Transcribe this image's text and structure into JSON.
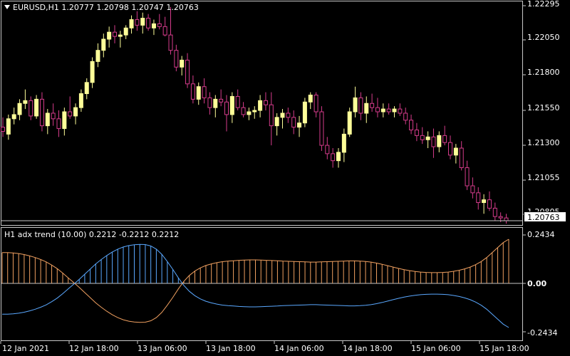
{
  "main_chart": {
    "title": "EURUSD,H1  1.20777 1.20798 1.20747 1.20763",
    "current_price": "1.20763",
    "price_labels": [
      "1.22295",
      "1.22050",
      "1.21800",
      "1.21550",
      "1.21300",
      "1.21055",
      "1.20805"
    ],
    "colors": {
      "bull": "#ffff99",
      "bear": "#d63c8c",
      "price_line": "#c8c8c8"
    }
  },
  "indicator": {
    "title": "H1 adx trend (10.00) 0.2212 -0.2212 0.2212",
    "level_labels": [
      "0.2434",
      "0.00",
      "-0.2434"
    ],
    "colors": {
      "up": "#5aa8ff",
      "down": "#f0a060"
    }
  },
  "time_axis": {
    "labels": [
      "12 Jan 2021",
      "12 Jan 18:00",
      "13 Jan 06:00",
      "13 Jan 18:00",
      "14 Jan 06:00",
      "14 Jan 18:00",
      "15 Jan 06:00",
      "15 Jan 18:00"
    ]
  },
  "chart_data": [
    {
      "type": "candlestick",
      "title": "EURUSD,H1",
      "ylim": [
        1.2075,
        1.2232
      ],
      "ohlc": [
        [
          1.2143,
          1.215,
          1.2136,
          1.214
        ],
        [
          1.2138,
          1.2152,
          1.2134,
          1.2149
        ],
        [
          1.2149,
          1.2157,
          1.2145,
          1.2152
        ],
        [
          1.2152,
          1.2163,
          1.2148,
          1.216
        ],
        [
          1.216,
          1.217,
          1.2156,
          1.2162
        ],
        [
          1.2162,
          1.2165,
          1.2148,
          1.2151
        ],
        [
          1.2151,
          1.2166,
          1.2149,
          1.2163
        ],
        [
          1.2163,
          1.2168,
          1.214,
          1.2144
        ],
        [
          1.2144,
          1.2156,
          1.2138,
          1.2153
        ],
        [
          1.2153,
          1.216,
          1.2144,
          1.2149
        ],
        [
          1.2149,
          1.2155,
          1.2136,
          1.2142
        ],
        [
          1.2142,
          1.2157,
          1.2137,
          1.2154
        ],
        [
          1.2154,
          1.2165,
          1.2149,
          1.2151
        ],
        [
          1.2151,
          1.216,
          1.2145,
          1.2157
        ],
        [
          1.2157,
          1.217,
          1.2154,
          1.2167
        ],
        [
          1.2167,
          1.2178,
          1.2163,
          1.2175
        ],
        [
          1.2175,
          1.2193,
          1.2171,
          1.219
        ],
        [
          1.219,
          1.2203,
          1.2186,
          1.2198
        ],
        [
          1.2198,
          1.221,
          1.2193,
          1.2206
        ],
        [
          1.2206,
          1.2215,
          1.22,
          1.2211
        ],
        [
          1.2211,
          1.2216,
          1.2203,
          1.2208
        ],
        [
          1.2208,
          1.2212,
          1.22,
          1.2209
        ],
        [
          1.2209,
          1.2216,
          1.2206,
          1.2214
        ],
        [
          1.2214,
          1.2223,
          1.221,
          1.222
        ],
        [
          1.222,
          1.2226,
          1.2212,
          1.2216
        ],
        [
          1.2216,
          1.2225,
          1.221,
          1.2221
        ],
        [
          1.2221,
          1.2224,
          1.2212,
          1.2214
        ],
        [
          1.2214,
          1.222,
          1.2209,
          1.2217
        ],
        [
          1.2217,
          1.2224,
          1.2213,
          1.2215
        ],
        [
          1.2215,
          1.2222,
          1.2208,
          1.2209
        ],
        [
          1.2209,
          1.2229,
          1.2195,
          1.2198
        ],
        [
          1.2198,
          1.2202,
          1.2183,
          1.2186
        ],
        [
          1.2186,
          1.2194,
          1.218,
          1.2191
        ],
        [
          1.2191,
          1.2196,
          1.2171,
          1.2174
        ],
        [
          1.2174,
          1.218,
          1.216,
          1.2163
        ],
        [
          1.2163,
          1.2175,
          1.2159,
          1.2172
        ],
        [
          1.2172,
          1.2178,
          1.216,
          1.2164
        ],
        [
          1.2164,
          1.2168,
          1.2152,
          1.2157
        ],
        [
          1.2157,
          1.2166,
          1.215,
          1.2163
        ],
        [
          1.2163,
          1.217,
          1.2158,
          1.2161
        ],
        [
          1.2161,
          1.2166,
          1.214,
          1.2152
        ],
        [
          1.2152,
          1.2168,
          1.2146,
          1.2165
        ],
        [
          1.2165,
          1.217,
          1.2155,
          1.2157
        ],
        [
          1.2157,
          1.2161,
          1.215,
          1.2152
        ],
        [
          1.2152,
          1.2157,
          1.2148,
          1.2154
        ],
        [
          1.2154,
          1.2158,
          1.2149,
          1.2155
        ],
        [
          1.2155,
          1.2166,
          1.215,
          1.2162
        ],
        [
          1.2162,
          1.2168,
          1.2155,
          1.2159
        ],
        [
          1.2159,
          1.2168,
          1.213,
          1.2144
        ],
        [
          1.2144,
          1.2153,
          1.2137,
          1.215
        ],
        [
          1.215,
          1.2156,
          1.2142,
          1.2153
        ],
        [
          1.2153,
          1.2157,
          1.2146,
          1.215
        ],
        [
          1.215,
          1.2155,
          1.2138,
          1.2143
        ],
        [
          1.2143,
          1.2151,
          1.2136,
          1.2146
        ],
        [
          1.2146,
          1.2164,
          1.2143,
          1.2161
        ],
        [
          1.2161,
          1.2168,
          1.2156,
          1.2166
        ],
        [
          1.2166,
          1.2168,
          1.215,
          1.2154
        ],
        [
          1.2154,
          1.2158,
          1.2126,
          1.213
        ],
        [
          1.213,
          1.2136,
          1.212,
          1.2124
        ],
        [
          1.2124,
          1.2128,
          1.2114,
          1.2119
        ],
        [
          1.2119,
          1.2128,
          1.2114,
          1.2125
        ],
        [
          1.2125,
          1.2142,
          1.2118,
          1.2138
        ],
        [
          1.2138,
          1.2157,
          1.2136,
          1.2154
        ],
        [
          1.2154,
          1.2172,
          1.215,
          1.2164
        ],
        [
          1.2164,
          1.2168,
          1.2148,
          1.2153
        ],
        [
          1.2153,
          1.2165,
          1.2146,
          1.216
        ],
        [
          1.216,
          1.2167,
          1.2154,
          1.2157
        ],
        [
          1.2157,
          1.2164,
          1.215,
          1.2154
        ],
        [
          1.2154,
          1.216,
          1.215,
          1.2156
        ],
        [
          1.2156,
          1.216,
          1.2152,
          1.2154
        ],
        [
          1.2154,
          1.2158,
          1.215,
          1.2156
        ],
        [
          1.2156,
          1.216,
          1.2151,
          1.2153
        ],
        [
          1.2153,
          1.2157,
          1.2145,
          1.2148
        ],
        [
          1.2148,
          1.2152,
          1.2138,
          1.2141
        ],
        [
          1.2141,
          1.2146,
          1.2133,
          1.2137
        ],
        [
          1.2137,
          1.2143,
          1.2131,
          1.2134
        ],
        [
          1.2134,
          1.214,
          1.2128,
          1.2136
        ],
        [
          1.2136,
          1.2142,
          1.2121,
          1.2129
        ],
        [
          1.2129,
          1.214,
          1.2125,
          1.2137
        ],
        [
          1.2137,
          1.2144,
          1.213,
          1.2132
        ],
        [
          1.2132,
          1.2137,
          1.212,
          1.2123
        ],
        [
          1.2123,
          1.2131,
          1.2117,
          1.2128
        ],
        [
          1.2128,
          1.2133,
          1.2112,
          1.2114
        ],
        [
          1.2114,
          1.2119,
          1.2098,
          1.2101
        ],
        [
          1.2101,
          1.2107,
          1.2092,
          1.2096
        ],
        [
          1.2096,
          1.21,
          1.2084,
          1.2089
        ],
        [
          1.2089,
          1.2095,
          1.2081,
          1.2091
        ],
        [
          1.2091,
          1.2097,
          1.2083,
          1.2085
        ],
        [
          1.2085,
          1.2089,
          1.2076,
          1.2079
        ],
        [
          1.2079,
          1.2082,
          1.2075,
          1.2078
        ],
        [
          1.2078,
          1.2081,
          1.2074,
          1.2076
        ]
      ]
    },
    {
      "type": "bar+line",
      "title": "H1 adx trend (10.00)",
      "ylim": [
        -0.2434,
        0.2434
      ],
      "series": [
        {
          "values": [
            0.155,
            0.155,
            0.153,
            0.15,
            0.145,
            0.138,
            0.13,
            0.12,
            0.108,
            0.092,
            0.074,
            0.052,
            0.028,
            0.004,
            -0.02,
            -0.046,
            -0.072,
            -0.098,
            -0.12,
            -0.14,
            -0.158,
            -0.172,
            -0.183,
            -0.19,
            -0.194,
            -0.196,
            -0.195,
            -0.188,
            -0.172,
            -0.146,
            -0.11,
            -0.07,
            -0.028,
            0.01,
            0.04,
            0.062,
            0.078,
            0.09,
            0.098,
            0.104,
            0.109,
            0.112,
            0.114,
            0.116,
            0.117,
            0.118,
            0.118,
            0.117,
            0.116,
            0.115,
            0.114,
            0.112,
            0.111,
            0.11,
            0.109,
            0.108,
            0.107,
            0.107,
            0.108,
            0.109,
            0.11,
            0.111,
            0.112,
            0.113,
            0.113,
            0.112,
            0.11,
            0.107,
            0.102,
            0.096,
            0.089,
            0.082,
            0.075,
            0.069,
            0.064,
            0.06,
            0.057,
            0.055,
            0.054,
            0.054,
            0.055,
            0.057,
            0.061,
            0.066,
            0.073,
            0.082,
            0.094,
            0.11,
            0.13,
            0.155,
            0.18,
            0.205,
            0.222
          ]
        },
        {
          "values": [
            -0.155,
            -0.155,
            -0.153,
            -0.15,
            -0.145,
            -0.138,
            -0.13,
            -0.12,
            -0.108,
            -0.092,
            -0.074,
            -0.052,
            -0.028,
            -0.004,
            0.02,
            0.046,
            0.072,
            0.098,
            0.12,
            0.14,
            0.158,
            0.172,
            0.183,
            0.19,
            0.194,
            0.196,
            0.195,
            0.188,
            0.172,
            0.146,
            0.11,
            0.07,
            0.028,
            -0.01,
            -0.04,
            -0.062,
            -0.078,
            -0.09,
            -0.098,
            -0.104,
            -0.109,
            -0.112,
            -0.114,
            -0.116,
            -0.117,
            -0.118,
            -0.118,
            -0.117,
            -0.116,
            -0.115,
            -0.114,
            -0.112,
            -0.111,
            -0.11,
            -0.109,
            -0.108,
            -0.107,
            -0.107,
            -0.108,
            -0.109,
            -0.11,
            -0.111,
            -0.112,
            -0.113,
            -0.113,
            -0.112,
            -0.11,
            -0.107,
            -0.102,
            -0.096,
            -0.089,
            -0.082,
            -0.075,
            -0.069,
            -0.064,
            -0.06,
            -0.057,
            -0.055,
            -0.054,
            -0.054,
            -0.055,
            -0.057,
            -0.061,
            -0.066,
            -0.073,
            -0.082,
            -0.094,
            -0.11,
            -0.13,
            -0.155,
            -0.18,
            -0.205,
            -0.222
          ]
        }
      ]
    }
  ]
}
